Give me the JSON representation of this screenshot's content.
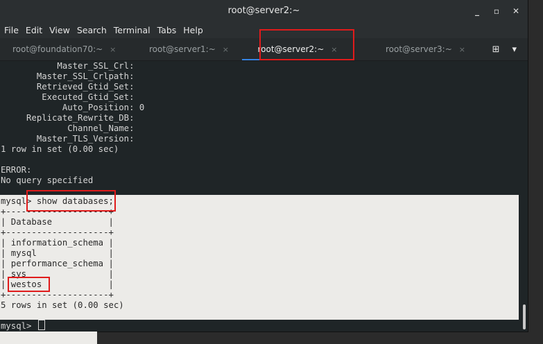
{
  "window": {
    "title": "root@server2:~",
    "controls": [
      "_",
      "▫",
      "✕"
    ]
  },
  "menu": [
    "File",
    "Edit",
    "View",
    "Search",
    "Terminal",
    "Tabs",
    "Help"
  ],
  "tabs": [
    {
      "label": "root@foundation70:~",
      "close": "×",
      "active": false
    },
    {
      "label": "root@server1:~",
      "close": "×",
      "active": false
    },
    {
      "label": "root@server2:~",
      "close": "×",
      "active": true
    },
    {
      "label": "root@server3:~",
      "close": "×",
      "active": false
    }
  ],
  "tab_tools": {
    "new_tab_icon": "new-tab-icon",
    "menu_icon": "chevron-down-icon",
    "new_tab_glyph": "⊞",
    "menu_glyph": "▾"
  },
  "terminal": {
    "dark_lines": [
      "           Master_SSL_Crl:",
      "       Master_SSL_Crlpath:",
      "       Retrieved_Gtid_Set:",
      "        Executed_Gtid_Set:",
      "            Auto_Position: 0",
      "     Replicate_Rewrite_DB:",
      "             Channel_Name:",
      "       Master_TLS_Version:",
      "1 row in set (0.00 sec)",
      "",
      "ERROR:",
      "No query specified",
      ""
    ],
    "light_lines": [
      "mysql> show databases;",
      "+--------------------+",
      "| Database           |",
      "+--------------------+",
      "| information_schema |",
      "| mysql              |",
      "| performance_schema |",
      "| sys                |",
      "| westos             |",
      "+--------------------+",
      "5 rows in set (0.00 sec)",
      ""
    ],
    "prompt": "mysql> "
  },
  "colors": {
    "highlight": "#e01b1b",
    "active_tab_underline": "#3584e4"
  }
}
